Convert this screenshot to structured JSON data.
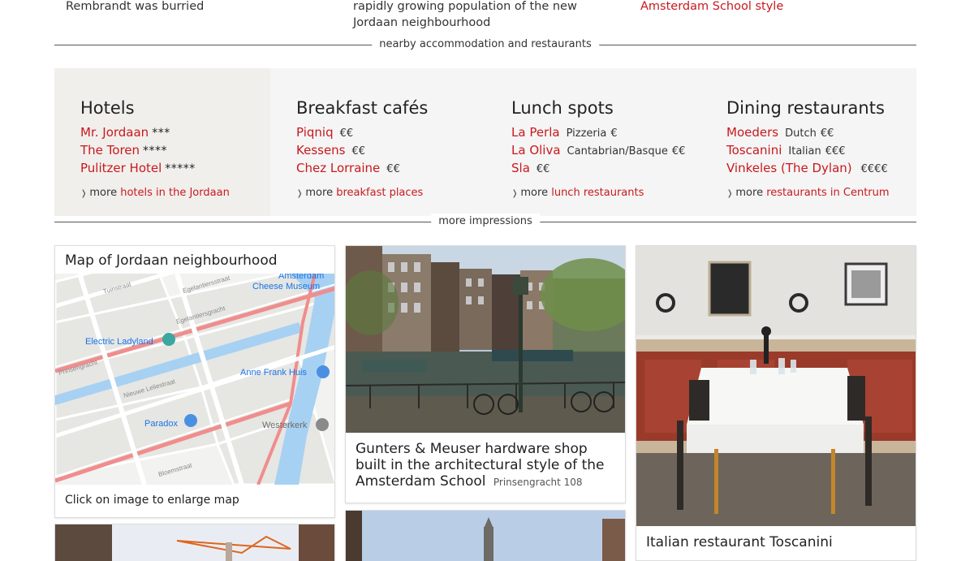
{
  "top_row": {
    "col1": "Rembrandt was burried",
    "col2": "rapidly growing population of the new Jordaan neighbourhood",
    "col3_link": "Amsterdam School style"
  },
  "dividers": {
    "accommodation": "nearby accommodation and restaurants",
    "impressions": "more impressions"
  },
  "panels": [
    {
      "title": "Hotels",
      "items": [
        {
          "name": "Mr. Jordaan",
          "stars": "***"
        },
        {
          "name": "The Toren",
          "stars": "****"
        },
        {
          "name": "Pulitzer Hotel",
          "stars": "*****"
        }
      ],
      "more_prefix": "more",
      "more_link": "hotels in the Jordaan"
    },
    {
      "title": "Breakfast cafés",
      "items": [
        {
          "name": "Piqniq",
          "price": "€€"
        },
        {
          "name": "Kessens",
          "price": "€€"
        },
        {
          "name": "Chez Lorraine",
          "price": "€€"
        }
      ],
      "more_prefix": "more",
      "more_link": "breakfast places"
    },
    {
      "title": "Lunch spots",
      "items": [
        {
          "name": "La Perla",
          "type": "Pizzeria",
          "price": "€"
        },
        {
          "name": "La Oliva",
          "type": "Cantabrian/Basque",
          "price": "€€"
        },
        {
          "name": "Sla",
          "price": "€€"
        }
      ],
      "more_prefix": "more",
      "more_link": "lunch restaurants"
    },
    {
      "title": "Dining restaurants",
      "items": [
        {
          "name": "Moeders",
          "type": "Dutch",
          "price": "€€"
        },
        {
          "name": "Toscanini",
          "type": "Italian",
          "price": "€€€"
        },
        {
          "name": "Vinkeles (The Dylan)",
          "price": "€€€€"
        }
      ],
      "more_prefix": "more",
      "more_link": "restaurants in Centrum"
    }
  ],
  "map_card": {
    "title": "Map of Jordaan neighbourhood",
    "caption": "Click on image to enlarge map",
    "labels": {
      "museum1": "Amsterdam",
      "museum2": "Cheese Museum",
      "electric": "Electric Ladyland",
      "anne": "Anne Frank Huis",
      "paradox": "Paradox",
      "westerkerk": "Westerkerk",
      "s1": "Tuinstraat",
      "s2": "Egelantiersstraat",
      "s3": "Egelantiersgracht",
      "s4": "Nieuwe Leliestraat",
      "s5": "Bloemstraat",
      "s6": "Prinsengracht"
    }
  },
  "photo_card": {
    "caption": "Gunters & Meuser hardware shop built in the architectural style of the Amsterdam School",
    "address": "Prinsengracht 108"
  },
  "rest_card": {
    "caption": "Italian restaurant Toscanini"
  },
  "colors": {
    "accent": "#c8191e",
    "panel_bg": "#f5f5f5",
    "panel_hotels_bg": "#f1efec",
    "map_water": "#a7d1f2",
    "map_road": "#f08d8d"
  }
}
